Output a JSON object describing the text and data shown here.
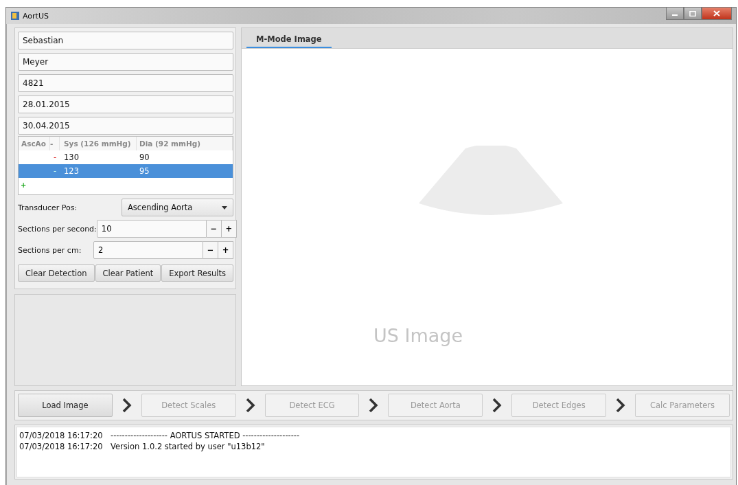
{
  "window": {
    "title": "AortUS"
  },
  "patient_fields": [
    {
      "value": "Sebastian"
    },
    {
      "value": "Meyer"
    },
    {
      "value": "4821"
    },
    {
      "value": "28.01.2015"
    },
    {
      "value": "30.04.2015"
    }
  ],
  "table": {
    "columns": [
      "AscAo",
      "-",
      "Sys (126 mmHg)",
      "Dia (92 mmHg)"
    ],
    "rows": [
      {
        "remove": "-",
        "sys": "130",
        "dia": "90",
        "selected": false
      },
      {
        "remove": "-",
        "sys": "123",
        "dia": "95",
        "selected": true
      }
    ],
    "add": "+"
  },
  "transducer": {
    "label": "Transducer Pos:",
    "value": "Ascending Aorta"
  },
  "spinners": [
    {
      "label": "Sections per second:",
      "value": "10",
      "minus": "−",
      "plus": "+"
    },
    {
      "label": "Sections per cm:",
      "value": "2",
      "minus": "−",
      "plus": "+"
    }
  ],
  "buttons": [
    "Clear Detection",
    "Clear Patient",
    "Export Results"
  ],
  "tabs": [
    {
      "label": "M-Mode Image",
      "selected": true
    }
  ],
  "image_placeholder": "US Image",
  "steps": [
    {
      "label": "Load Image",
      "disabled": false
    },
    {
      "label": "Detect Scales",
      "disabled": true
    },
    {
      "label": "Detect ECG",
      "disabled": true
    },
    {
      "label": "Detect Aorta",
      "disabled": true
    },
    {
      "label": "Detect Edges",
      "disabled": true
    },
    {
      "label": "Calc Parameters",
      "disabled": true
    }
  ],
  "log": [
    {
      "time": "07/03/2018 16:17:20",
      "message": "-------------------- AORTUS STARTED --------------------"
    },
    {
      "time": "07/03/2018 16:17:20",
      "message": "Version 1.0.2 started by user \"u13b12\""
    }
  ]
}
